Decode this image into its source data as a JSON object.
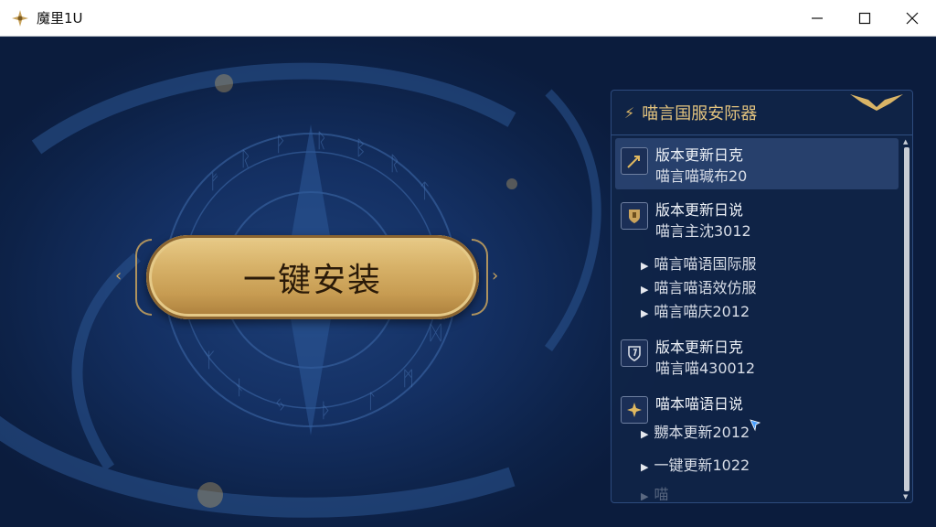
{
  "window": {
    "title": "魔里1U"
  },
  "main": {
    "install_button_label": "一键安装",
    "left_arrow": "‹",
    "right_arrow": "›"
  },
  "panel": {
    "title": "喵言国服安际器",
    "entries": [
      {
        "title": "版本更新日克",
        "subtitle": "喵言喵瑊布20",
        "icon": "arrow-icon"
      },
      {
        "title": "版本更新日说",
        "subtitle": "喵言主沈3012",
        "icon": "shield-scroll-icon"
      },
      {
        "title": "版本更新日克",
        "subtitle": "喵言喵430012",
        "icon": "shield-icon"
      },
      {
        "title": "喵本喵语日说",
        "icon": "star-sword-icon"
      }
    ],
    "subitems_a": [
      "喵言喵语国际服",
      "喵言喵语效仿服",
      "喵言喵庆2012"
    ],
    "subitems_b": [
      "嬲本更新2012",
      "一键更新1022"
    ],
    "faded_item": "喵 "
  }
}
